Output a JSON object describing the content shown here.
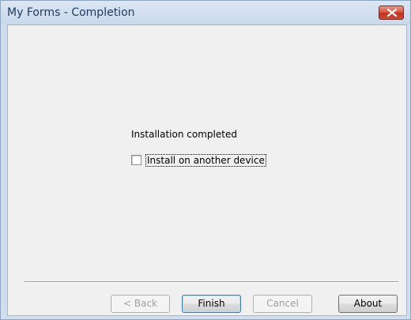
{
  "window": {
    "title": "My Forms - Completion"
  },
  "content": {
    "message": "Installation completed",
    "checkbox_label": "Install on another device",
    "checkbox_checked": false
  },
  "buttons": {
    "back": "< Back",
    "finish": "Finish",
    "cancel": "Cancel",
    "about": "About"
  },
  "icons": {
    "close": "close-x-icon"
  },
  "colors": {
    "close_button": "#c1321d",
    "title_text": "#1e395b",
    "dialog_bg": "#f0f0f0"
  }
}
